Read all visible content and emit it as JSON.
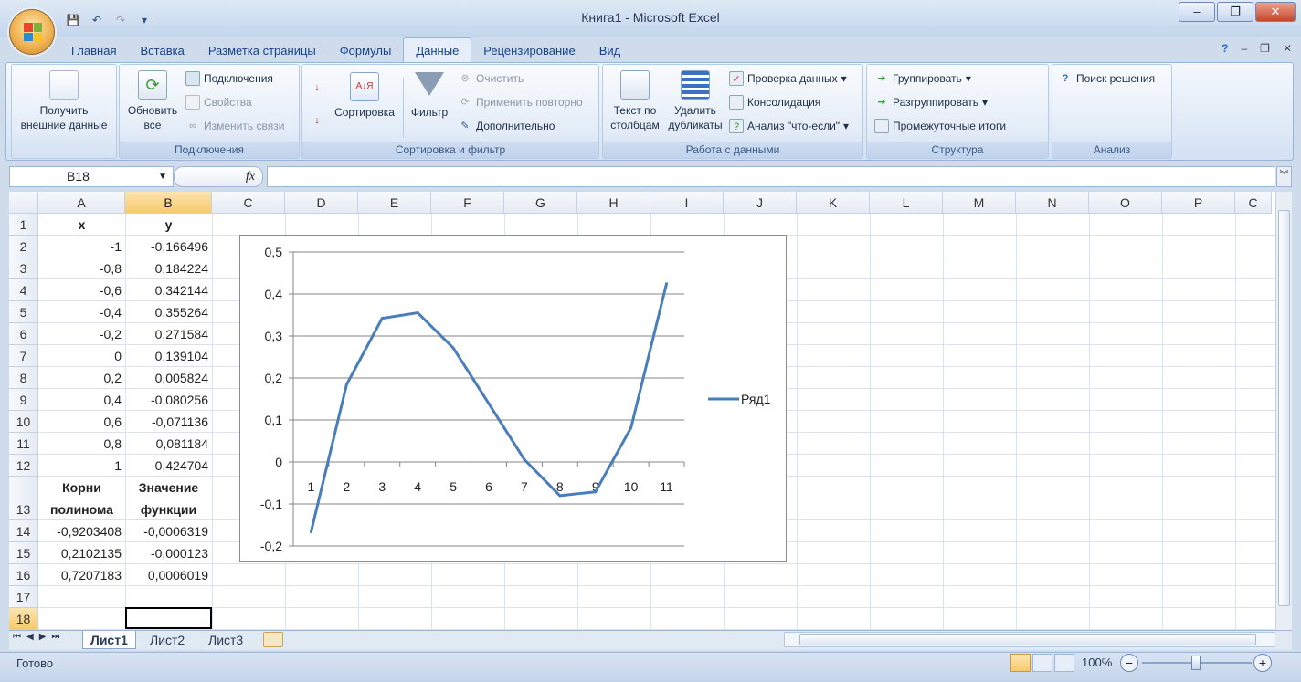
{
  "window": {
    "title": "Книга1 - Microsoft Excel",
    "minimize": "–",
    "restore": "❐",
    "close": "✕"
  },
  "qat": {
    "save": "💾",
    "undo": "↶",
    "redo": "↷",
    "more": "▾"
  },
  "tabs": [
    "Главная",
    "Вставка",
    "Разметка страницы",
    "Формулы",
    "Данные",
    "Рецензирование",
    "Вид"
  ],
  "active_tab": "Данные",
  "ribbon_right": {
    "help": "?",
    "min": "–",
    "restore": "❐",
    "close": "✕"
  },
  "ribbon": {
    "get_external": "Получить внешние данные",
    "refresh_all": "Обновить все",
    "connections": "Подключения",
    "properties": "Свойства",
    "edit_links": "Изменить связи",
    "group_connections": "Подключения",
    "sort_az": "А↓Я",
    "sort": "Сортировка",
    "filter": "Фильтр",
    "clear": "Очистить",
    "reapply": "Применить повторно",
    "advanced": "Дополнительно",
    "group_sort": "Сортировка и фильтр",
    "text_to_columns": "Текст по столбцам",
    "remove_duplicates": "Удалить дубликаты",
    "data_validation": "Проверка данных",
    "consolidate": "Консолидация",
    "whatif": "Анализ \"что-если\"",
    "group_data": "Работа с данными",
    "group": "Группировать",
    "ungroup": "Разгруппировать",
    "subtotal": "Промежуточные итоги",
    "group_outline": "Структура",
    "solver": "Поиск решения",
    "group_analysis": "Анализ"
  },
  "formula_bar": {
    "name_box": "B18",
    "fx": "fx",
    "formula": ""
  },
  "columns": [
    "A",
    "B",
    "C",
    "D",
    "E",
    "F",
    "G",
    "H",
    "I",
    "J",
    "K",
    "L",
    "M",
    "N",
    "O",
    "P",
    "C"
  ],
  "rows": [
    "1",
    "2",
    "3",
    "4",
    "5",
    "6",
    "7",
    "8",
    "9",
    "10",
    "11",
    "12",
    "13",
    "14",
    "15",
    "16",
    "17",
    "18"
  ],
  "cells": {
    "A1": "x",
    "B1": "y",
    "A2": "-1",
    "B2": "-0,166496",
    "A3": "-0,8",
    "B3": "0,184224",
    "A4": "-0,6",
    "B4": "0,342144",
    "A5": "-0,4",
    "B5": "0,355264",
    "A6": "-0,2",
    "B6": "0,271584",
    "A7": "0",
    "B7": "0,139104",
    "A8": "0,2",
    "B8": "0,005824",
    "A9": "0,4",
    "B9": "-0,080256",
    "A10": "0,6",
    "B10": "-0,071136",
    "A11": "0,8",
    "B11": "0,081184",
    "A12": "1",
    "B12": "0,424704",
    "A13a": "Корни",
    "A13b": "полинома",
    "B13a": "Значение",
    "B13b": "функции",
    "A14": "-0,9203408",
    "B14": "-0,0006319",
    "A15": "0,2102135",
    "B15": "-0,000123",
    "A16": "0,7207183",
    "B16": "0,0006019"
  },
  "chart_data": {
    "type": "line",
    "categories": [
      "1",
      "2",
      "3",
      "4",
      "5",
      "6",
      "7",
      "8",
      "9",
      "10",
      "11"
    ],
    "series": [
      {
        "name": "Ряд1",
        "values": [
          -0.166496,
          0.184224,
          0.342144,
          0.355264,
          0.271584,
          0.139104,
          0.005824,
          -0.080256,
          -0.071136,
          0.081184,
          0.424704
        ],
        "color": "#4a7ebb"
      }
    ],
    "y_ticks": [
      "0,5",
      "0,4",
      "0,3",
      "0,2",
      "0,1",
      "0",
      "-0,1",
      "-0,2"
    ],
    "ylim": [
      -0.2,
      0.5
    ],
    "grid": true,
    "legend": "right"
  },
  "sheets": [
    "Лист1",
    "Лист2",
    "Лист3"
  ],
  "active_sheet": "Лист1",
  "status": {
    "ready": "Готово",
    "zoom": "100%",
    "minus": "−",
    "plus": "+"
  }
}
